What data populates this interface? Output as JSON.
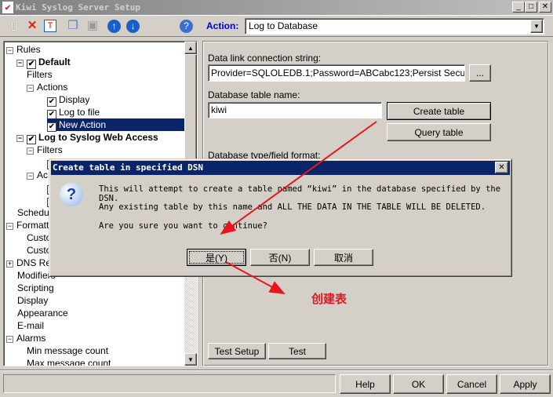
{
  "window": {
    "title": "Kiwi Syslog Server Setup",
    "min": "_",
    "max": "□",
    "close": "✕"
  },
  "toolbar": {
    "icons": [
      "new-icon",
      "delete-icon",
      "rename-icon",
      "copy-icon",
      "paste-icon",
      "move-up-icon",
      "move-down-icon",
      "help-icon"
    ]
  },
  "tree": {
    "items": [
      {
        "label": "Rules",
        "expander": "−",
        "check": false,
        "bold": false
      },
      {
        "label": "Default",
        "expander": "−",
        "check": true,
        "bold": true
      },
      {
        "label": "Filters",
        "expander": "",
        "check": false,
        "bold": false
      },
      {
        "label": "Actions",
        "expander": "−",
        "check": false,
        "bold": false
      },
      {
        "label": "Display",
        "expander": "",
        "check": true,
        "bold": false
      },
      {
        "label": "Log to file",
        "expander": "",
        "check": true,
        "bold": false
      },
      {
        "label": "New Action",
        "expander": "",
        "check": true,
        "bold": false,
        "selected": true
      },
      {
        "label": "Log to Syslog Web Access",
        "expander": "−",
        "check": true,
        "bold": true
      },
      {
        "label": "Filters",
        "expander": "−",
        "check": false,
        "bold": false
      },
      {
        "label": "",
        "expander": "",
        "check": true,
        "bold": false
      },
      {
        "label": "Ac",
        "expander": "−",
        "check": false,
        "bold": false
      },
      {
        "label": "",
        "expander": "",
        "check": true,
        "bold": false
      },
      {
        "label": "",
        "expander": "",
        "check": true,
        "bold": false
      },
      {
        "label": "Schedul",
        "expander": "",
        "check": false,
        "bold": false
      },
      {
        "label": "Formattin",
        "expander": "−",
        "check": false,
        "bold": false
      },
      {
        "label": "Custo",
        "expander": "",
        "check": false,
        "bold": false
      },
      {
        "label": "Custo",
        "expander": "",
        "check": false,
        "bold": false
      },
      {
        "label": "DNS Re",
        "expander": "+",
        "check": false,
        "bold": false
      },
      {
        "label": "Modifiers",
        "expander": "",
        "check": false,
        "bold": false
      },
      {
        "label": "Scripting",
        "expander": "",
        "check": false,
        "bold": false
      },
      {
        "label": "Display",
        "expander": "",
        "check": false,
        "bold": false
      },
      {
        "label": "Appearance",
        "expander": "",
        "check": false,
        "bold": false
      },
      {
        "label": "E-mail",
        "expander": "",
        "check": false,
        "bold": false
      },
      {
        "label": "Alarms",
        "expander": "−",
        "check": false,
        "bold": false
      },
      {
        "label": "Min message count",
        "expander": "",
        "check": false,
        "bold": false
      },
      {
        "label": "Max message count",
        "expander": "",
        "check": false,
        "bold": false
      }
    ]
  },
  "action": {
    "label": "Action:",
    "value": "Log to Database"
  },
  "form": {
    "conn_label": "Data link connection string:",
    "conn_value": "Provider=SQLOLEDB.1;Password=ABCabc123;Persist Security Info=",
    "browse": "...",
    "table_label": "Database table name:",
    "table_value": "kiwi",
    "create_table": "Create table",
    "query_table": "Query table",
    "db_type_label": "Database type/field format:",
    "test_setup": "Test Setup",
    "test": "Test"
  },
  "footer": {
    "help": "Help",
    "ok": "OK",
    "cancel": "Cancel",
    "apply": "Apply"
  },
  "dialog": {
    "title": "Create table in specified DSN",
    "line1": "This will attempt to create a table named “kiwi” in the database specified by the DSN.",
    "line2": "Any existing table by this name and ALL THE DATA IN THE TABLE WILL BE DELETED.",
    "line3": "Are you sure you want to continue?",
    "yes": "是(Y)",
    "no": "否(N)",
    "cancel": "取消"
  },
  "annotation": {
    "text": "创建表",
    "color": "#e8141e"
  }
}
